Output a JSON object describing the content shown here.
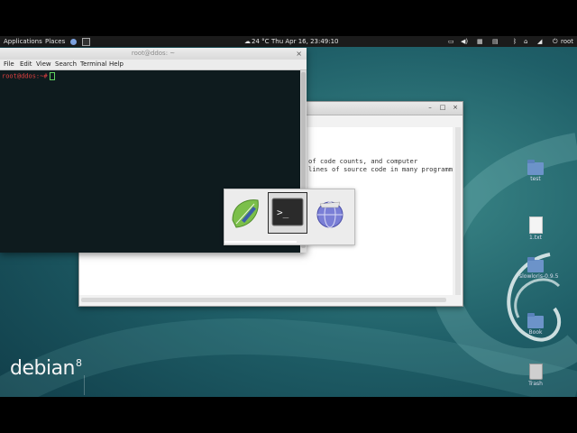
{
  "top_panel": {
    "applications_label": "Applications",
    "places_label": "Places",
    "weather": "24 °C",
    "clock": "Thu Apr 16, 23:49:10",
    "user": "root"
  },
  "terminal": {
    "title": "root@ddos: ~",
    "menu": [
      "File",
      "Edit",
      "View",
      "Search",
      "Terminal",
      "Help"
    ],
    "prompt_user": "root@ddos:~#",
    "prompt_symbol": ""
  },
  "background_window": {
    "lines": [
      "of code counts, and computer",
      "lines of source code in many programm"
    ]
  },
  "switcher": {
    "items": [
      "text-editor-icon",
      "terminal-icon",
      "browser-icon"
    ],
    "selected_index": 1
  },
  "desktop_icons": [
    {
      "label": "test",
      "type": "folder"
    },
    {
      "label": "1.txt",
      "type": "file"
    },
    {
      "label": "slowloris-0.9.5",
      "type": "folder"
    },
    {
      "label": "Book",
      "type": "folder"
    },
    {
      "label": "Trash",
      "type": "trash"
    }
  ],
  "branding": {
    "name": "debian",
    "version": "8"
  },
  "colors": {
    "terminal_bg": "#0e1b1e",
    "prompt": "#e04040",
    "panel": "#1b1b1b"
  }
}
